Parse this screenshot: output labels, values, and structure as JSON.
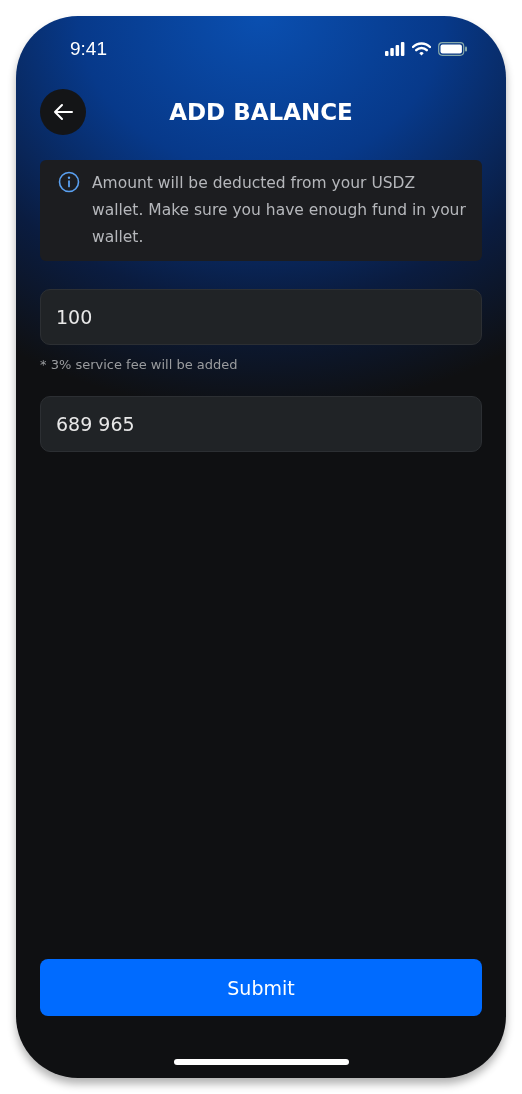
{
  "status_bar": {
    "time": "9:41"
  },
  "header": {
    "title": "ADD BALANCE"
  },
  "info": {
    "text": "Amount will be deducted from your USDZ wallet. Make sure you have enough fund in your wallet."
  },
  "amount_field": {
    "value": "100"
  },
  "fee_note": "* 3% service fee will be added",
  "second_field": {
    "value": "689 965"
  },
  "submit_button": {
    "label": "Submit"
  }
}
